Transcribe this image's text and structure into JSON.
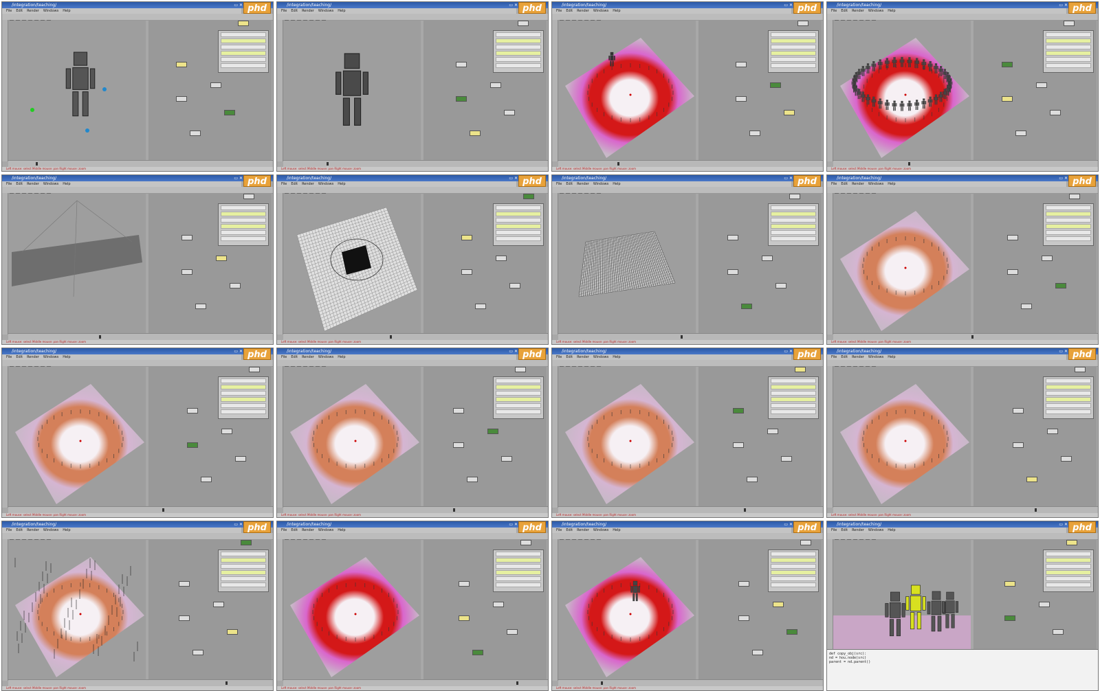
{
  "app": {
    "logo_text": "phd",
    "title_prefix": "/integration/teaching/",
    "menu_labels": [
      "File",
      "Edit",
      "Render",
      "Windows",
      "Help"
    ],
    "status_text": "Left mouse: select  Middle mouse: pan  Right mouse: zoom"
  },
  "colors": {
    "titlebar": "#2c5aa8",
    "viewport_bg": "#9e9e9e",
    "heat_red": "#d41818",
    "heat_magenta": "#d966cc",
    "heat_white": "#f6f0f4",
    "heat_orange": "#d4805a",
    "node_yellow": "#ece38a",
    "node_green": "#4a8a3c",
    "logo_orange": "#e8a23a"
  },
  "tiles": [
    {
      "id": "t1",
      "variant": "figure-dance"
    },
    {
      "id": "t2",
      "variant": "figure-stand"
    },
    {
      "id": "t3",
      "variant": "heatmap-red-persp"
    },
    {
      "id": "t4",
      "variant": "crowd-ring"
    },
    {
      "id": "t5",
      "variant": "gray-plane"
    },
    {
      "id": "t6",
      "variant": "grid-square"
    },
    {
      "id": "t7",
      "variant": "dense-grid"
    },
    {
      "id": "t8",
      "variant": "heatmap-orange"
    },
    {
      "id": "t9",
      "variant": "heatmap-orange"
    },
    {
      "id": "t10",
      "variant": "heatmap-orange"
    },
    {
      "id": "t11",
      "variant": "heatmap-orange"
    },
    {
      "id": "t12",
      "variant": "heatmap-pink-wide"
    },
    {
      "id": "t13",
      "variant": "heatmap-spikes"
    },
    {
      "id": "t14",
      "variant": "heatmap-red-big"
    },
    {
      "id": "t15",
      "variant": "heatmap-red-figure"
    },
    {
      "id": "t16",
      "variant": "figures-group"
    }
  ],
  "expr_lines": [
    "def copy_obj(src):",
    "    nd = hou.node(src)",
    "    parent = nd.parent()"
  ]
}
